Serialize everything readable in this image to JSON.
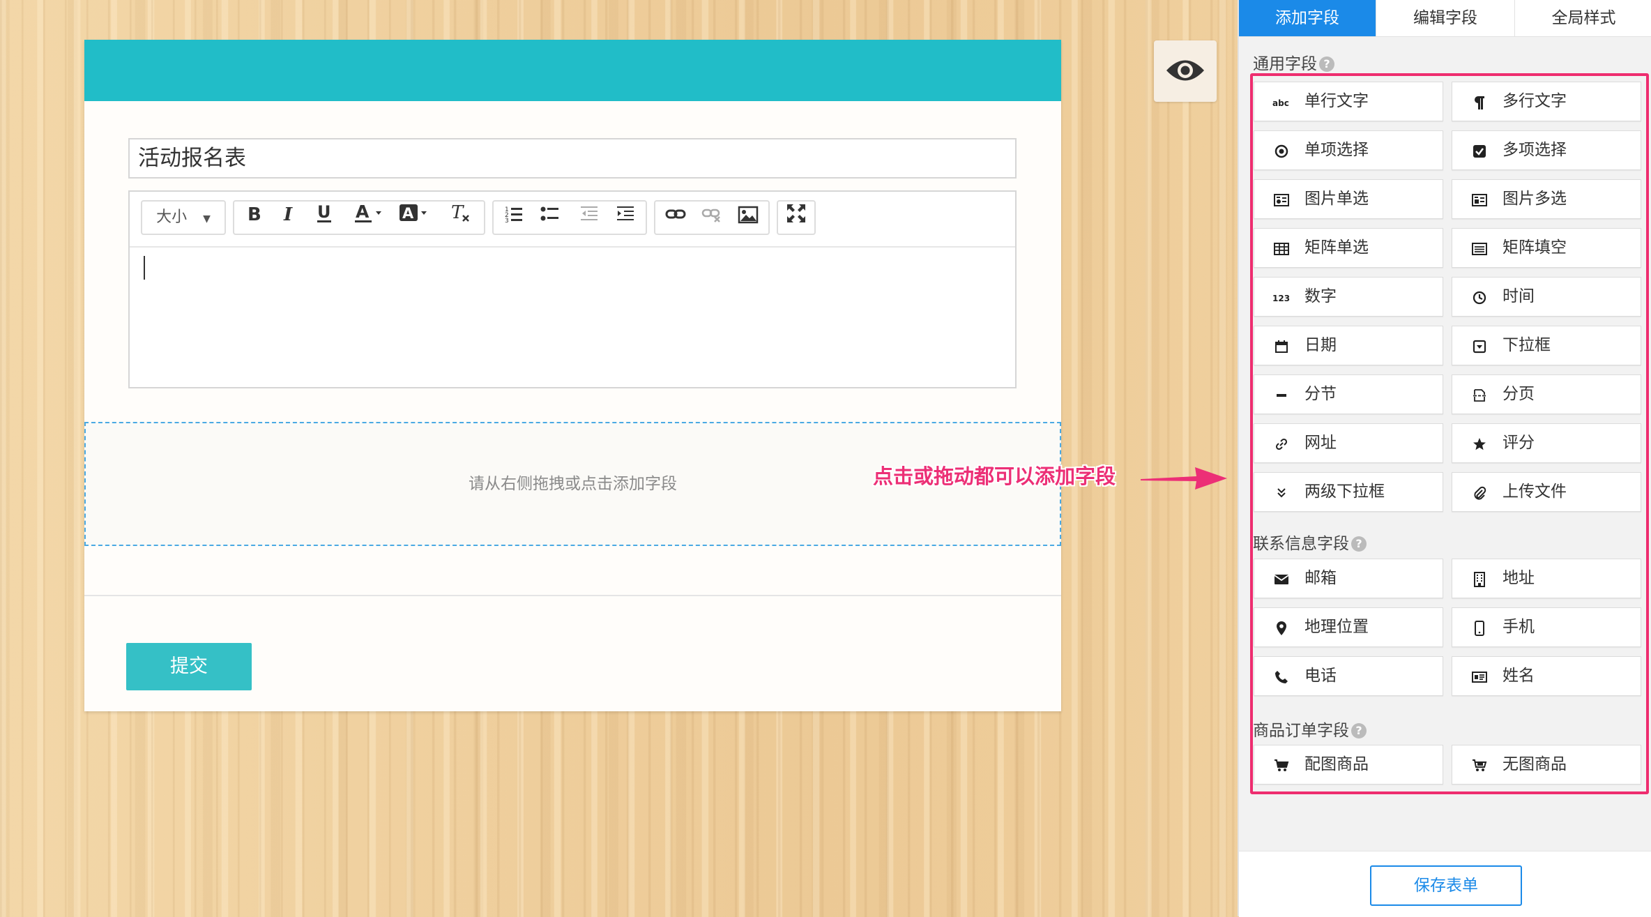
{
  "form": {
    "title_value": "活动报名表",
    "editor_toolbar": {
      "size_label": "大小"
    },
    "dropzone_text": "请从右侧拖拽或点击添加字段",
    "submit_label": "提交",
    "header_color": "#21bdc8"
  },
  "annotation": {
    "text": "点击或拖动都可以添加字段",
    "color": "#ec2f76"
  },
  "panel": {
    "tabs": [
      {
        "label": "添加字段",
        "active": true
      },
      {
        "label": "编辑字段",
        "active": false
      },
      {
        "label": "全局样式",
        "active": false
      }
    ],
    "sections": [
      {
        "title": "通用字段",
        "fields": [
          {
            "label": "单行文字",
            "icon": "abc-icon"
          },
          {
            "label": "多行文字",
            "icon": "paragraph-icon"
          },
          {
            "label": "单项选择",
            "icon": "radio-icon"
          },
          {
            "label": "多项选择",
            "icon": "checkbox-icon"
          },
          {
            "label": "图片单选",
            "icon": "image-radio-icon"
          },
          {
            "label": "图片多选",
            "icon": "image-checkbox-icon"
          },
          {
            "label": "矩阵单选",
            "icon": "table-icon"
          },
          {
            "label": "矩阵填空",
            "icon": "list-box-icon"
          },
          {
            "label": "数字",
            "icon": "number-icon"
          },
          {
            "label": "时间",
            "icon": "clock-icon"
          },
          {
            "label": "日期",
            "icon": "calendar-icon"
          },
          {
            "label": "下拉框",
            "icon": "dropdown-icon"
          },
          {
            "label": "分节",
            "icon": "minus-icon"
          },
          {
            "label": "分页",
            "icon": "page-break-icon"
          },
          {
            "label": "网址",
            "icon": "link-icon"
          },
          {
            "label": "评分",
            "icon": "star-icon"
          },
          {
            "label": "两级下拉框",
            "icon": "double-chevron-down-icon"
          },
          {
            "label": "上传文件",
            "icon": "paperclip-icon"
          }
        ]
      },
      {
        "title": "联系信息字段",
        "fields": [
          {
            "label": "邮箱",
            "icon": "envelope-icon"
          },
          {
            "label": "地址",
            "icon": "building-icon"
          },
          {
            "label": "地理位置",
            "icon": "map-marker-icon"
          },
          {
            "label": "手机",
            "icon": "mobile-icon"
          },
          {
            "label": "电话",
            "icon": "phone-icon"
          },
          {
            "label": "姓名",
            "icon": "id-card-icon"
          }
        ]
      },
      {
        "title": "商品订单字段",
        "fields": [
          {
            "label": "配图商品",
            "icon": "cart-icon"
          },
          {
            "label": "无图商品",
            "icon": "cart-alt-icon"
          }
        ]
      }
    ],
    "help_glyph": "?",
    "save_label": "保存表单",
    "accent_color": "#1b8ae8",
    "highlight_color": "#ee2d6f"
  }
}
